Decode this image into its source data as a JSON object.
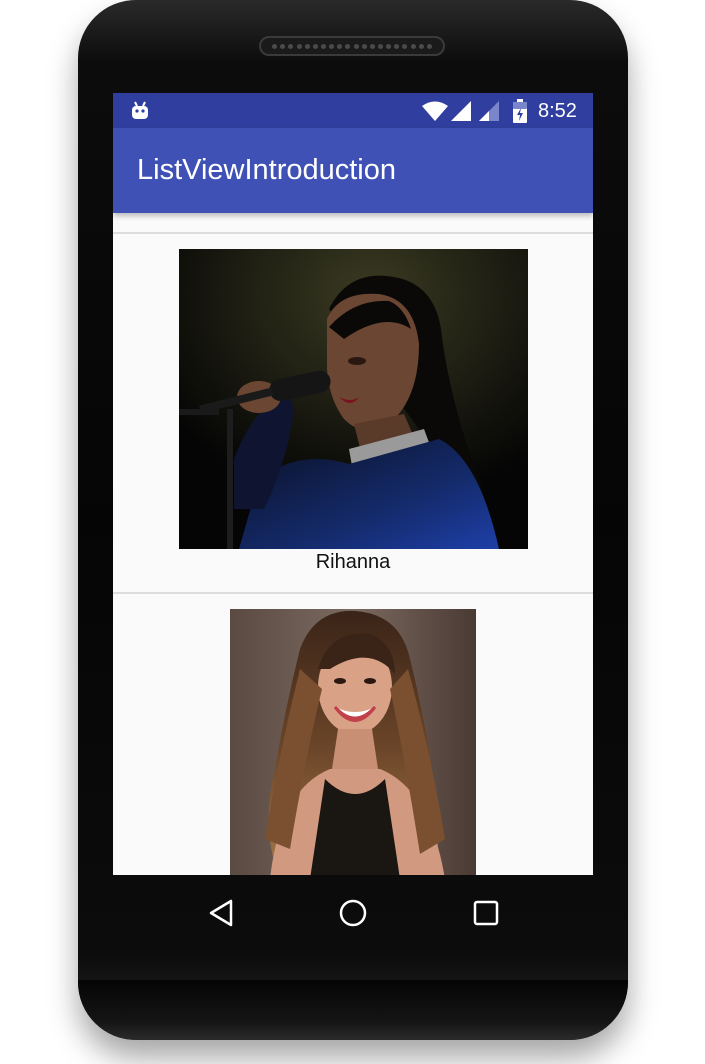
{
  "status_bar": {
    "time": "8:52",
    "icons": [
      "android-icon",
      "wifi-icon",
      "signal-icon",
      "battery-icon"
    ]
  },
  "app_bar": {
    "title": "ListViewIntroduction"
  },
  "list": {
    "items": [
      {
        "caption": "Rihanna",
        "image": "rihanna-photo"
      },
      {
        "caption": "",
        "image": "selena-photo"
      }
    ]
  },
  "nav_bar": {
    "buttons": [
      "back-icon",
      "home-icon",
      "recents-icon"
    ]
  },
  "colors": {
    "status_bar": "#303f9f",
    "app_bar": "#3f51b5",
    "list_background": "#fafafa",
    "divider": "#dcdcdc"
  }
}
